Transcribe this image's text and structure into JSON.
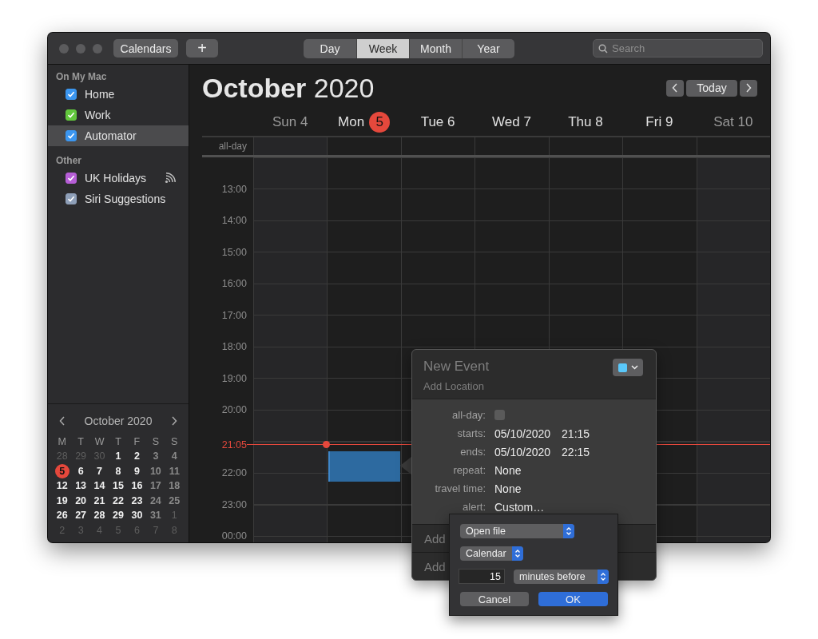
{
  "toolbar": {
    "calendars_button": "Calendars",
    "add_button": "+",
    "views": [
      {
        "label": "Day",
        "selected": false
      },
      {
        "label": "Week",
        "selected": true
      },
      {
        "label": "Month",
        "selected": false
      },
      {
        "label": "Year",
        "selected": false
      }
    ],
    "search": {
      "placeholder": "Search"
    }
  },
  "sidebar": {
    "groups": [
      {
        "heading": "On My Mac",
        "items": [
          {
            "label": "Home",
            "color": "#3b96f0",
            "checked": true,
            "selected": false,
            "subscribed": false
          },
          {
            "label": "Work",
            "color": "#62c73d",
            "checked": true,
            "selected": false,
            "subscribed": false
          },
          {
            "label": "Automator",
            "color": "#3b96f0",
            "checked": true,
            "selected": true,
            "subscribed": false
          }
        ]
      },
      {
        "heading": "Other",
        "items": [
          {
            "label": "UK Holidays",
            "color": "#b65ed6",
            "checked": true,
            "selected": false,
            "subscribed": true
          },
          {
            "label": "Siri Suggestions",
            "color": "#8e9fb8",
            "checked": true,
            "selected": false,
            "subscribed": false
          }
        ]
      }
    ]
  },
  "mini_calendar": {
    "title": "October 2020",
    "weekdays": [
      "M",
      "T",
      "W",
      "T",
      "F",
      "S",
      "S"
    ],
    "weeks": [
      [
        {
          "label": "28",
          "kind": "adjacent"
        },
        {
          "label": "29",
          "kind": "adjacent"
        },
        {
          "label": "30",
          "kind": "adjacent"
        },
        {
          "label": "1",
          "kind": "day"
        },
        {
          "label": "2",
          "kind": "day"
        },
        {
          "label": "3",
          "kind": "weekend"
        },
        {
          "label": "4",
          "kind": "weekend"
        }
      ],
      [
        {
          "label": "5",
          "kind": "today"
        },
        {
          "label": "6",
          "kind": "day"
        },
        {
          "label": "7",
          "kind": "day"
        },
        {
          "label": "8",
          "kind": "day"
        },
        {
          "label": "9",
          "kind": "day"
        },
        {
          "label": "10",
          "kind": "weekend"
        },
        {
          "label": "11",
          "kind": "weekend"
        }
      ],
      [
        {
          "label": "12",
          "kind": "day"
        },
        {
          "label": "13",
          "kind": "day"
        },
        {
          "label": "14",
          "kind": "day"
        },
        {
          "label": "15",
          "kind": "day"
        },
        {
          "label": "16",
          "kind": "day"
        },
        {
          "label": "17",
          "kind": "weekend"
        },
        {
          "label": "18",
          "kind": "weekend"
        }
      ],
      [
        {
          "label": "19",
          "kind": "day"
        },
        {
          "label": "20",
          "kind": "day"
        },
        {
          "label": "21",
          "kind": "day"
        },
        {
          "label": "22",
          "kind": "day"
        },
        {
          "label": "23",
          "kind": "day"
        },
        {
          "label": "24",
          "kind": "weekend"
        },
        {
          "label": "25",
          "kind": "weekend"
        }
      ],
      [
        {
          "label": "26",
          "kind": "day"
        },
        {
          "label": "27",
          "kind": "day"
        },
        {
          "label": "28",
          "kind": "day"
        },
        {
          "label": "29",
          "kind": "day"
        },
        {
          "label": "30",
          "kind": "day"
        },
        {
          "label": "31",
          "kind": "weekend"
        },
        {
          "label": "1",
          "kind": "adjacent"
        }
      ],
      [
        {
          "label": "2",
          "kind": "adjacent"
        },
        {
          "label": "3",
          "kind": "adjacent"
        },
        {
          "label": "4",
          "kind": "adjacent"
        },
        {
          "label": "5",
          "kind": "adjacent"
        },
        {
          "label": "6",
          "kind": "adjacent"
        },
        {
          "label": "7",
          "kind": "adjacent"
        },
        {
          "label": "8",
          "kind": "adjacent"
        }
      ]
    ]
  },
  "header": {
    "title": "**October** 2020",
    "today_button": "Today"
  },
  "week": {
    "all_day_label": "all-day",
    "days": [
      {
        "label": "Sun 4",
        "kind": "weekend"
      },
      {
        "label": "Mon",
        "badge": "5",
        "kind": "today"
      },
      {
        "label": "Tue 6",
        "kind": "day"
      },
      {
        "label": "Wed 7",
        "kind": "day"
      },
      {
        "label": "Thu 8",
        "kind": "day"
      },
      {
        "label": "Fri 9",
        "kind": "day"
      },
      {
        "label": "Sat 10",
        "kind": "weekend"
      }
    ],
    "time_labels": [
      {
        "label": "13:00",
        "kind": "hour"
      },
      {
        "label": "14:00",
        "kind": "hour"
      },
      {
        "label": "15:00",
        "kind": "hour"
      },
      {
        "label": "16:00",
        "kind": "hour"
      },
      {
        "label": "17:00",
        "kind": "hour"
      },
      {
        "label": "18:00",
        "kind": "hour"
      },
      {
        "label": "19:00",
        "kind": "hour"
      },
      {
        "label": "20:00",
        "kind": "hour"
      },
      {
        "label": "21:05",
        "kind": "now"
      },
      {
        "label": "22:00",
        "kind": "hour"
      },
      {
        "label": "23:00",
        "kind": "hour"
      },
      {
        "label": "00:00",
        "kind": "hour"
      }
    ]
  },
  "new_event": {
    "title_placeholder": "New Event",
    "location_placeholder": "Add Location",
    "color": "#5ac8fa",
    "fields": [
      {
        "label": "all-day:",
        "kind": "checkbox",
        "checked": false
      },
      {
        "label": "starts:",
        "kind": "datetime",
        "date": "05/10/2020",
        "time": "21:15"
      },
      {
        "label": "ends:",
        "kind": "datetime",
        "date": "05/10/2020",
        "time": "22:15"
      },
      {
        "label": "repeat:",
        "kind": "text",
        "value": "None"
      },
      {
        "label": "travel time:",
        "kind": "text",
        "value": "None"
      },
      {
        "label": "alert:",
        "kind": "text",
        "value": "Custom…"
      }
    ],
    "more_rows": [
      "Add",
      "Add"
    ]
  },
  "alert_popup": {
    "action": "Open file",
    "target": "Calendar",
    "amount": "15",
    "unit": "minutes before",
    "cancel_button": "Cancel",
    "ok_button": "OK"
  }
}
